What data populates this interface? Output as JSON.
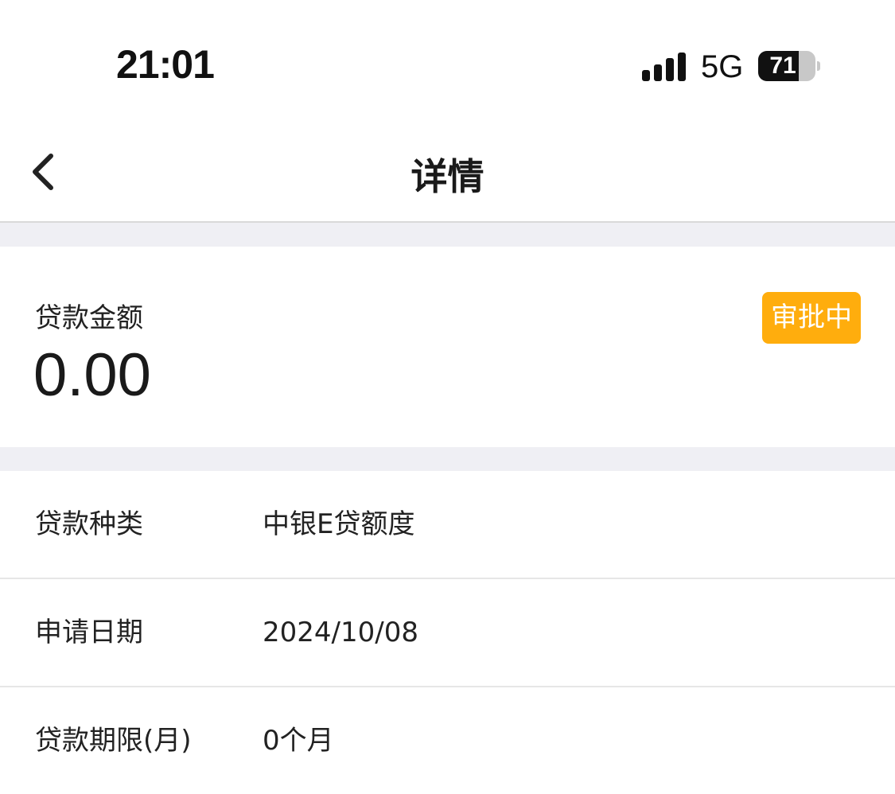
{
  "status_bar": {
    "time": "21:01",
    "network": "5G",
    "battery_level": "71",
    "signal_icon": "cellular-signal-icon",
    "battery_icon": "battery-icon"
  },
  "nav": {
    "back_icon": "chevron-left-icon",
    "title": "详情"
  },
  "summary": {
    "amount_label": "贷款金额",
    "amount_value": "0.00",
    "status": "审批中",
    "status_color": "#FFAD0D"
  },
  "details": [
    {
      "label": "贷款种类",
      "value": "中银E贷额度"
    },
    {
      "label": "申请日期",
      "value": "2024/10/08"
    },
    {
      "label": "贷款期限(月)",
      "value": "0个月"
    }
  ],
  "colors": {
    "background": "#FFFFFF",
    "section_gap": "#EFEFF4",
    "divider": "#E6E6E6",
    "text": "#1A1A1A"
  }
}
